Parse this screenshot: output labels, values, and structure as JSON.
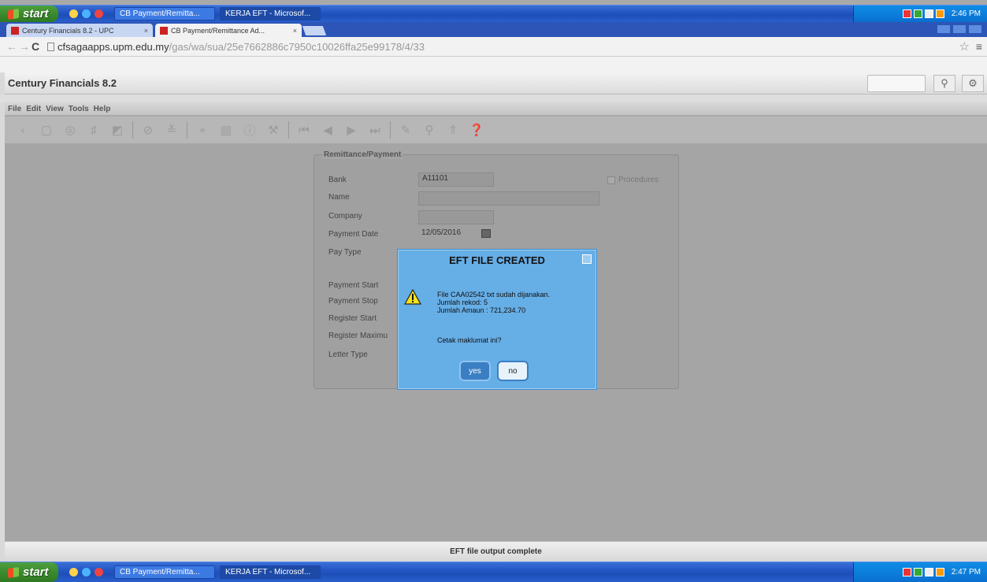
{
  "taskbar": {
    "start_label": "start",
    "tasks": [
      "CB Payment/Remitta...",
      "KERJA EFT - Microsof..."
    ],
    "clock_top": "2:46 PM",
    "clock_bottom": "2:47 PM"
  },
  "browser": {
    "tabs": [
      {
        "label": "Century Financials 8.2 - UPC"
      },
      {
        "label": "CB Payment/Remittance Ad..."
      }
    ],
    "url_host": "cfsagaapps.upm.edu.my",
    "url_path": "/gas/wa/sua/25e7662886c7950c10026ffa25e99178/4/33"
  },
  "app": {
    "title": "Century Financials 8.2",
    "menu": [
      "File",
      "Edit",
      "View",
      "Tools",
      "Help"
    ]
  },
  "form": {
    "legend": "Remittance/Payment",
    "labels": {
      "bank": "Bank",
      "name": "Name",
      "company": "Company",
      "payment_date": "Payment Date",
      "pay_type": "Pay Type",
      "payment_start": "Payment Start",
      "payment_stop": "Payment Stop",
      "register_start": "Register Start",
      "register_maximum": "Register Maximu",
      "letter_type": "Letter Type"
    },
    "values": {
      "bank": "A11101",
      "payment_date": "12/05/2016"
    },
    "procedures_label": "Procedures"
  },
  "dialog": {
    "title": "EFT FILE CREATED",
    "line1": "File CAA02542 txt sudah dijanakan.",
    "line2": "Jumlah rekod: 5",
    "line3": "Jumlah Amaun : 721,234.70",
    "question": "Cetak maklumat ini?",
    "yes_label": "yes",
    "no_label": "no"
  },
  "status": {
    "message": "EFT file output complete"
  }
}
